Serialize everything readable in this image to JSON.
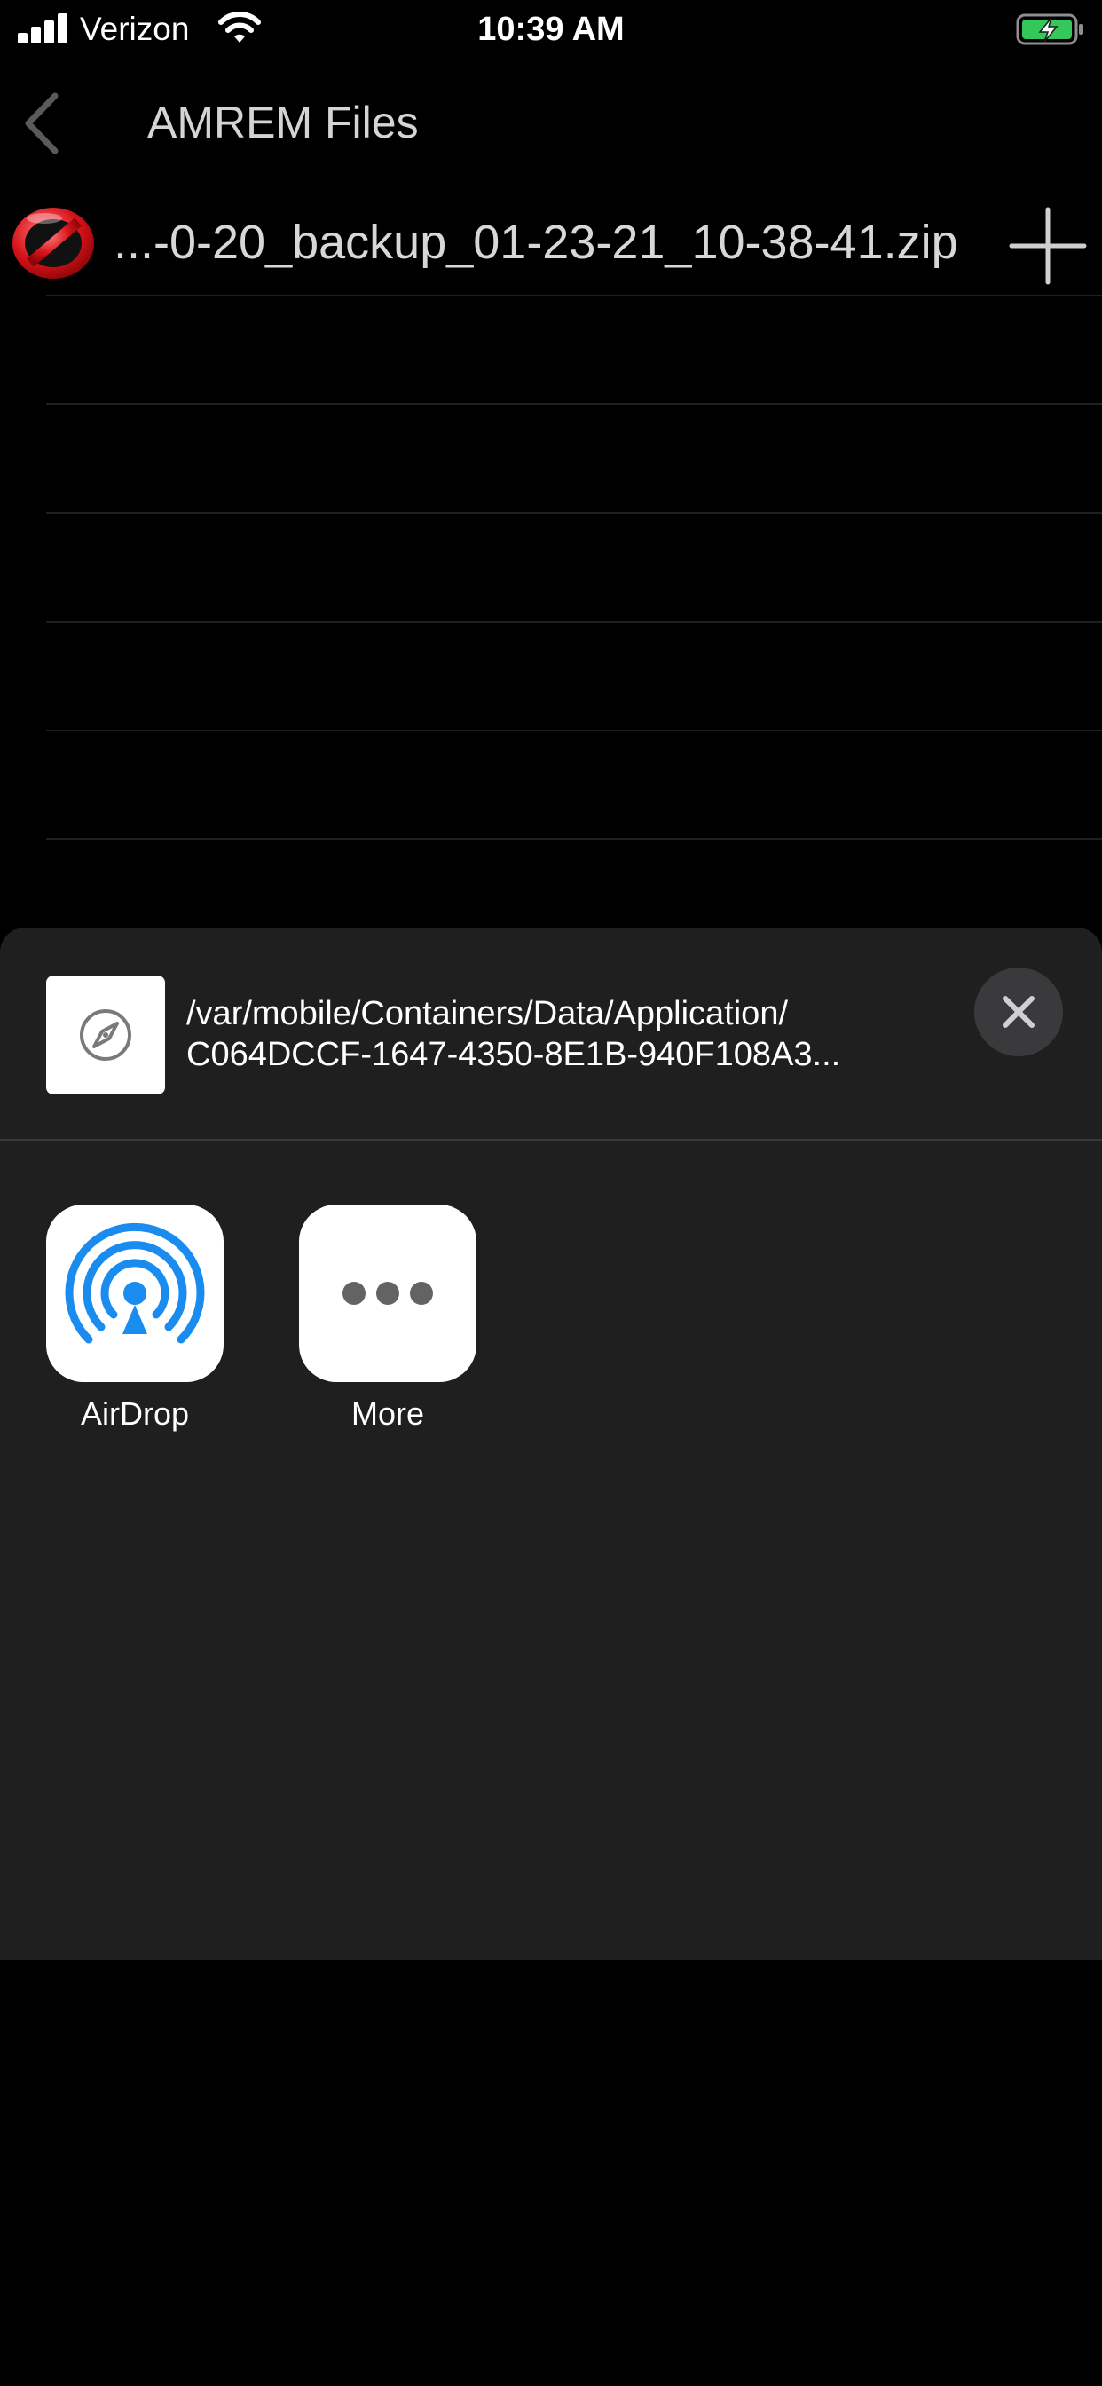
{
  "status_bar": {
    "carrier": "Verizon",
    "time": "10:39 AM",
    "signal_bars": 4,
    "battery_charging": true,
    "battery_color": "#34c759"
  },
  "nav": {
    "back_icon": "chevron-left-icon",
    "title": "AMREM Files"
  },
  "files": [
    {
      "status_icon": "no-symbol-icon",
      "name": "...-0-20_backup_01-23-21_10-38-41.zip",
      "action_icon": "plus-icon"
    }
  ],
  "share_sheet": {
    "preview_icon": "compass-icon",
    "path_line1": "/var/mobile/Containers/Data/Application/",
    "path_line2": "C064DCCF-1647-4350-8E1B-940F108A3...",
    "close_icon": "close-icon",
    "apps": [
      {
        "label": "AirDrop",
        "icon": "airdrop-icon",
        "accent": "#1a8cf0"
      },
      {
        "label": "More",
        "icon": "more-icon",
        "accent": "#636366"
      }
    ]
  }
}
